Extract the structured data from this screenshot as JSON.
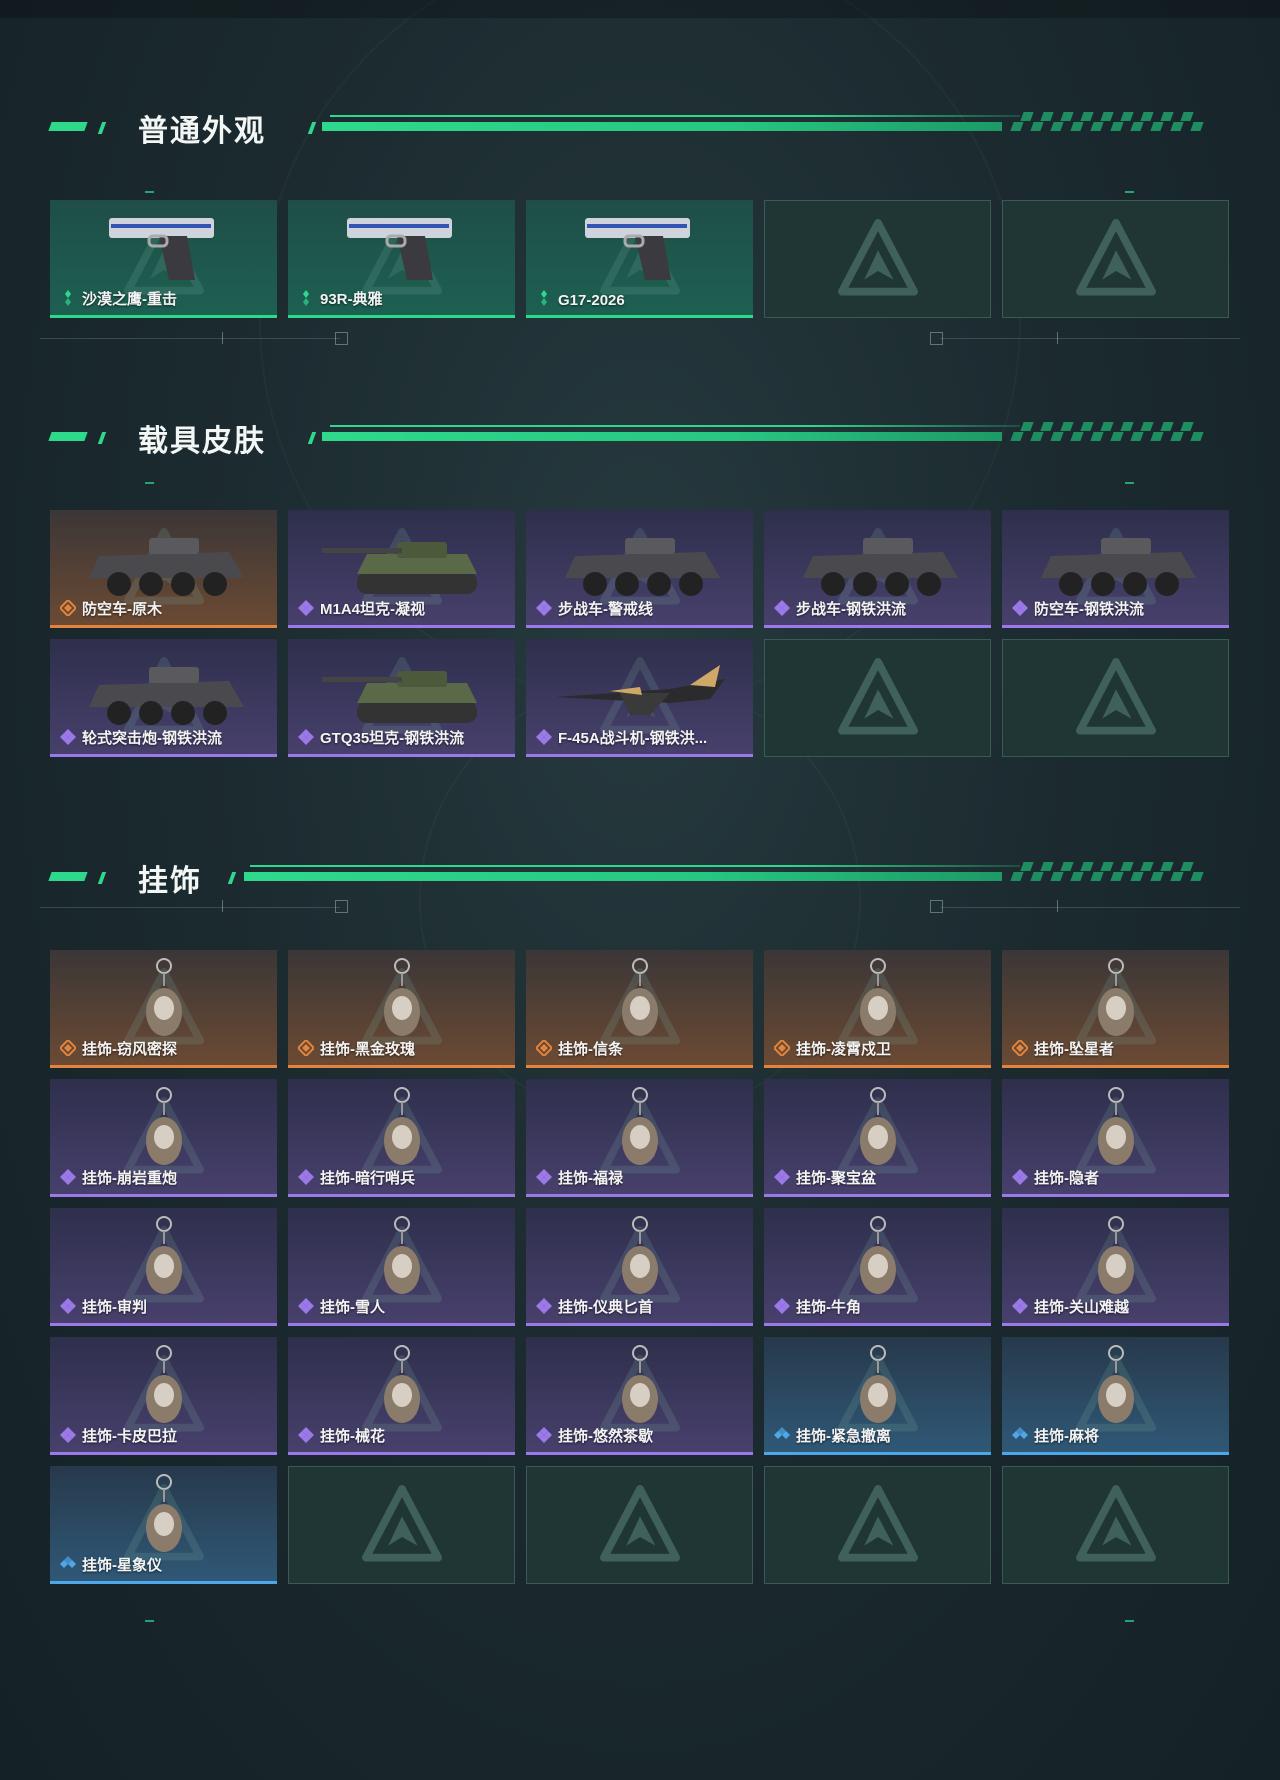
{
  "sections": {
    "weapons": {
      "title": "普通外观",
      "items": [
        {
          "name": "沙漠之鹰-重击",
          "rarity": "green",
          "icon": "desert-eagle-pistol-icon"
        },
        {
          "name": "93R-典雅",
          "rarity": "green",
          "icon": "93r-pistol-icon"
        },
        {
          "name": "G17-2026",
          "rarity": "green",
          "icon": "g17-pistol-icon"
        },
        {
          "name": "",
          "rarity": "empty"
        },
        {
          "name": "",
          "rarity": "empty"
        }
      ]
    },
    "vehicles": {
      "title": "载具皮肤",
      "items": [
        {
          "name": "防空车-原木",
          "rarity": "orange",
          "icon": "aa-vehicle-icon"
        },
        {
          "name": "M1A4坦克-凝视",
          "rarity": "purple",
          "icon": "tank-icon"
        },
        {
          "name": "步战车-警戒线",
          "rarity": "purple",
          "icon": "ifv-icon"
        },
        {
          "name": "步战车-钢铁洪流",
          "rarity": "purple",
          "icon": "ifv-icon"
        },
        {
          "name": "防空车-钢铁洪流",
          "rarity": "purple",
          "icon": "aa-vehicle-icon"
        },
        {
          "name": "轮式突击炮-钢铁洪流",
          "rarity": "purple",
          "icon": "wheeled-assault-gun-icon"
        },
        {
          "name": "GTQ35坦克-钢铁洪流",
          "rarity": "purple",
          "icon": "tank-icon"
        },
        {
          "name": "F-45A战斗机-钢铁洪...",
          "rarity": "purple",
          "icon": "fighter-jet-icon"
        },
        {
          "name": "",
          "rarity": "empty"
        },
        {
          "name": "",
          "rarity": "empty"
        }
      ]
    },
    "charms": {
      "title": "挂饰",
      "items": [
        {
          "name": "挂饰-窃风密探",
          "rarity": "orange",
          "icon": "charm-icon"
        },
        {
          "name": "挂饰-黑金玫瑰",
          "rarity": "orange",
          "icon": "charm-icon"
        },
        {
          "name": "挂饰-信条",
          "rarity": "orange",
          "icon": "charm-icon"
        },
        {
          "name": "挂饰-凌霄戍卫",
          "rarity": "orange",
          "icon": "charm-icon"
        },
        {
          "name": "挂饰-坠星者",
          "rarity": "orange",
          "icon": "charm-icon"
        },
        {
          "name": "挂饰-崩岩重炮",
          "rarity": "purple",
          "icon": "charm-icon"
        },
        {
          "name": "挂饰-暗行哨兵",
          "rarity": "purple",
          "icon": "charm-icon"
        },
        {
          "name": "挂饰-福禄",
          "rarity": "purple",
          "icon": "charm-icon"
        },
        {
          "name": "挂饰-聚宝盆",
          "rarity": "purple",
          "icon": "charm-icon"
        },
        {
          "name": "挂饰-隐者",
          "rarity": "purple",
          "icon": "charm-icon"
        },
        {
          "name": "挂饰-审判",
          "rarity": "purple",
          "icon": "charm-icon"
        },
        {
          "name": "挂饰-雪人",
          "rarity": "purple",
          "icon": "charm-icon"
        },
        {
          "name": "挂饰-仪典匕首",
          "rarity": "purple",
          "icon": "charm-icon"
        },
        {
          "name": "挂饰-牛角",
          "rarity": "purple",
          "icon": "charm-icon"
        },
        {
          "name": "挂饰-关山难越",
          "rarity": "purple",
          "icon": "charm-icon"
        },
        {
          "name": "挂饰-卡皮巴拉",
          "rarity": "purple",
          "icon": "charm-icon"
        },
        {
          "name": "挂饰-械花",
          "rarity": "purple",
          "icon": "charm-icon"
        },
        {
          "name": "挂饰-悠然茶歇",
          "rarity": "purple",
          "icon": "charm-icon"
        },
        {
          "name": "挂饰-紧急撤离",
          "rarity": "blue",
          "icon": "charm-icon"
        },
        {
          "name": "挂饰-麻将",
          "rarity": "blue",
          "icon": "charm-icon"
        },
        {
          "name": "挂饰-星象仪",
          "rarity": "blue",
          "icon": "charm-icon"
        },
        {
          "name": "",
          "rarity": "empty"
        },
        {
          "name": "",
          "rarity": "empty"
        },
        {
          "name": "",
          "rarity": "empty"
        },
        {
          "name": "",
          "rarity": "empty"
        }
      ]
    }
  },
  "colors": {
    "accent": "#2ed98c",
    "green": "#2ed98c",
    "orange": "#e2843e",
    "purple": "#9b79e8",
    "blue": "#4ea7e8"
  }
}
